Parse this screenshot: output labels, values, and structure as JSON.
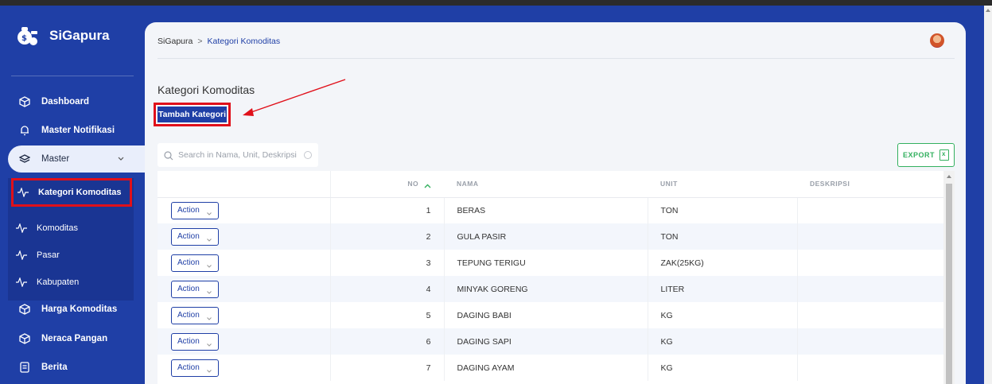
{
  "app": {
    "name": "SiGapura"
  },
  "sidebar": {
    "items": [
      {
        "label": "Dashboard",
        "icon": "cube-icon"
      },
      {
        "label": "Master Notifikasi",
        "icon": "bell-icon"
      },
      {
        "label": "Master",
        "icon": "layers-icon",
        "expanded": true
      },
      {
        "label": "Harga Komoditas",
        "icon": "cube-icon"
      },
      {
        "label": "Neraca Pangan",
        "icon": "cube-icon"
      },
      {
        "label": "Berita",
        "icon": "document-icon"
      }
    ],
    "submenu": [
      {
        "label": "Kategori Komoditas",
        "active": true
      },
      {
        "label": "Komoditas"
      },
      {
        "label": "Pasar"
      },
      {
        "label": "Kabupaten"
      }
    ]
  },
  "breadcrumb": {
    "root": "SiGapura",
    "separator": ">",
    "current": "Kategori Komoditas"
  },
  "page": {
    "title": "Kategori Komoditas",
    "add_button": "Tambah Kategori"
  },
  "search": {
    "placeholder": "Search in Nama, Unit, Deskripsi",
    "value": ""
  },
  "export": {
    "label": "EXPORT"
  },
  "table": {
    "headers": {
      "no": "NO",
      "nama": "NAMA",
      "unit": "UNIT",
      "deskripsi": "DESKRIPSI"
    },
    "sort": {
      "column": "NO",
      "direction": "ascending"
    },
    "action_label": "Action",
    "rows": [
      {
        "no": "1",
        "nama": "BERAS",
        "unit": "TON",
        "deskripsi": ""
      },
      {
        "no": "2",
        "nama": "GULA PASIR",
        "unit": "TON",
        "deskripsi": ""
      },
      {
        "no": "3",
        "nama": "TEPUNG TERIGU",
        "unit": "ZAK(25KG)",
        "deskripsi": ""
      },
      {
        "no": "4",
        "nama": "MINYAK GORENG",
        "unit": "LITER",
        "deskripsi": ""
      },
      {
        "no": "5",
        "nama": "DAGING BABI",
        "unit": "KG",
        "deskripsi": ""
      },
      {
        "no": "6",
        "nama": "DAGING SAPI",
        "unit": "KG",
        "deskripsi": ""
      },
      {
        "no": "7",
        "nama": "DAGING AYAM",
        "unit": "KG",
        "deskripsi": ""
      }
    ]
  },
  "colors": {
    "primary": "#1f3fa6",
    "highlight": "#e0101a",
    "export": "#33b05f"
  }
}
